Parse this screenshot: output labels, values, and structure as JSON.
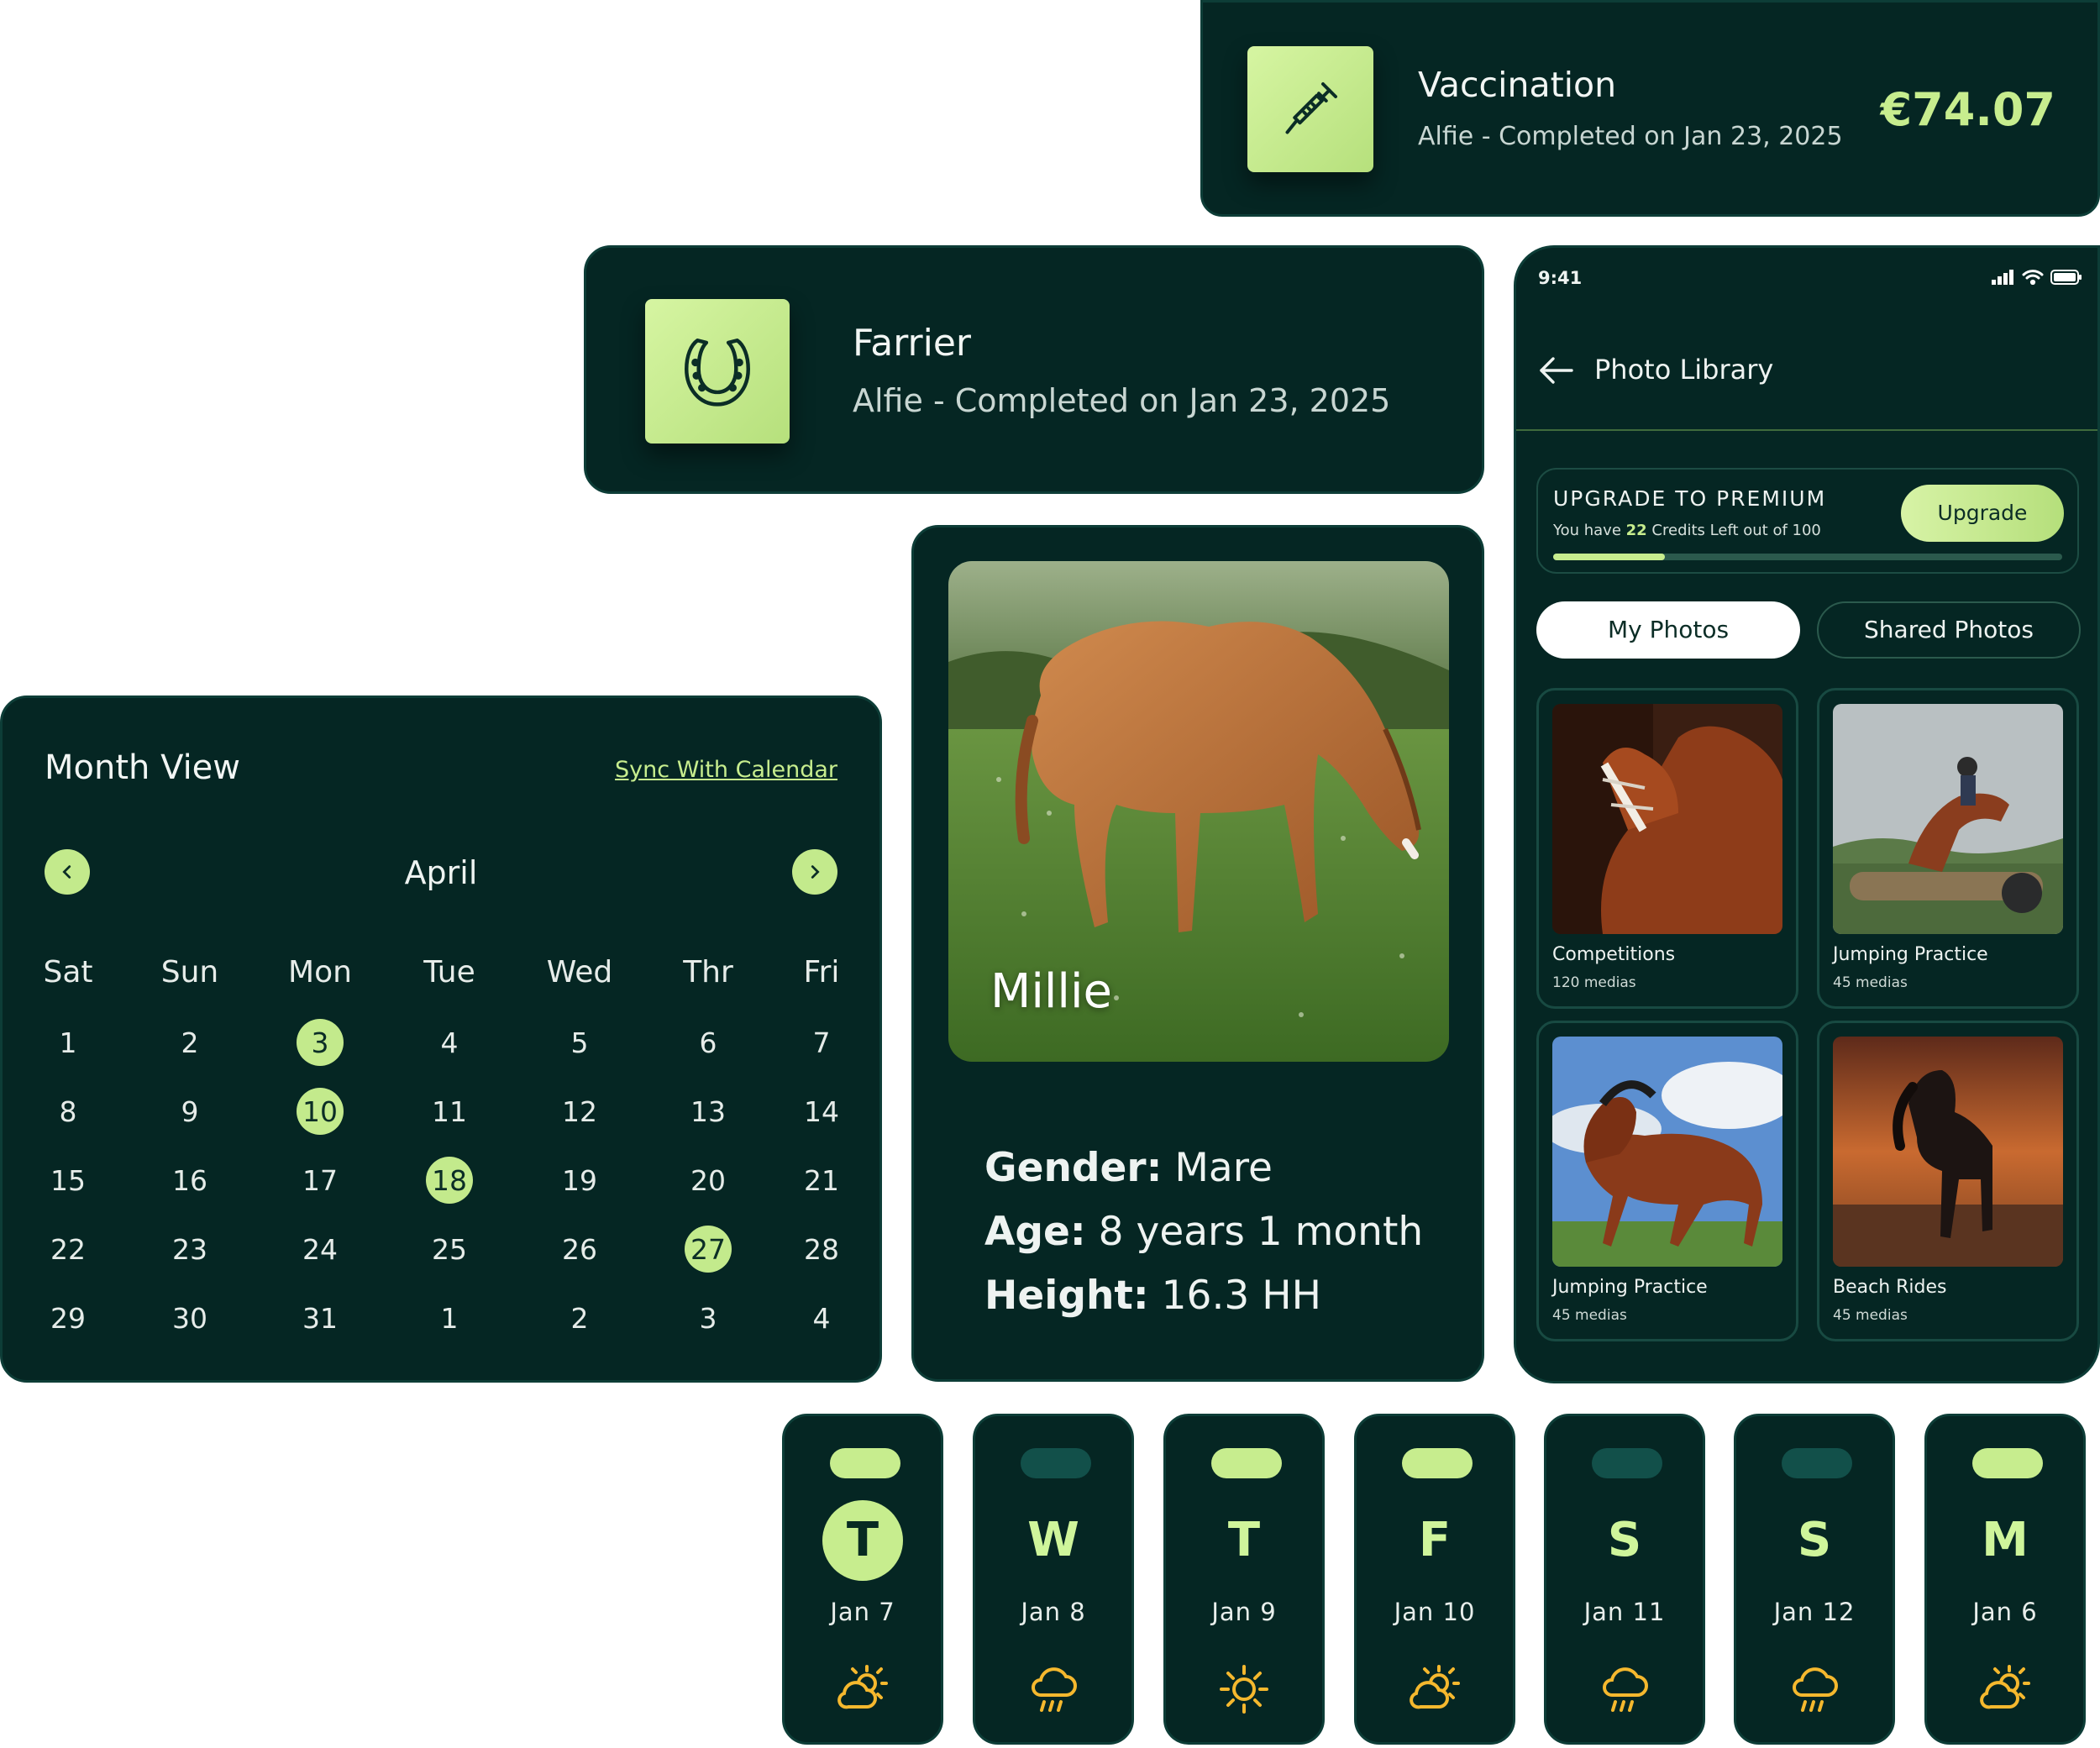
{
  "colors": {
    "card_bg": "#052623",
    "accent": "#c3ea8c",
    "weather_icon": "#f5b82e"
  },
  "vaccination": {
    "icon": "syringe-icon",
    "title": "Vaccination",
    "subtitle": "Alfie - Completed on Jan 23, 2025",
    "price": "€74.07"
  },
  "farrier": {
    "icon": "horseshoe-icon",
    "title": "Farrier",
    "subtitle": "Alfie - Completed on Jan 23, 2025"
  },
  "calendar": {
    "title": "Month View",
    "sync_link": "Sync With Calendar",
    "month": "April",
    "prev_icon": "chevron-left-icon",
    "next_icon": "chevron-right-icon",
    "weekdays": [
      "Sat",
      "Sun",
      "Mon",
      "Tue",
      "Wed",
      "Thr",
      "Fri"
    ],
    "weeks": [
      [
        "1",
        "2",
        "3",
        "4",
        "5",
        "6",
        "7"
      ],
      [
        "8",
        "9",
        "10",
        "11",
        "12",
        "13",
        "14"
      ],
      [
        "15",
        "16",
        "17",
        "18",
        "19",
        "20",
        "21"
      ],
      [
        "22",
        "23",
        "24",
        "25",
        "26",
        "27",
        "28"
      ],
      [
        "29",
        "30",
        "31",
        "1",
        "2",
        "3",
        "4"
      ]
    ],
    "highlighted": [
      "3",
      "10",
      "18",
      "27"
    ]
  },
  "horse": {
    "name": "Millie",
    "gender_label": "Gender:",
    "gender": "Mare",
    "age_label": "Age:",
    "age": "8 years 1 month",
    "height_label": "Height:",
    "height": "16.3 HH"
  },
  "phone": {
    "time": "9:41",
    "title": "Photo Library",
    "back_icon": "arrow-left-icon",
    "premium": {
      "heading": "UPGRADE TO PREMIUM",
      "text_before": "You have ",
      "credits": "22",
      "text_after": " Credits Left out of 100",
      "button": "Upgrade",
      "progress": 0.22
    },
    "tabs": [
      "My Photos",
      "Shared Photos"
    ],
    "active_tab": "My Photos",
    "albums": [
      {
        "name": "Competitions",
        "count": "120 medias"
      },
      {
        "name": "Jumping Practice",
        "count": "45 medias"
      },
      {
        "name": "Jumping Practice",
        "count": "45 medias"
      },
      {
        "name": "Beach Rides",
        "count": "45 medias"
      }
    ]
  },
  "weather": [
    {
      "letter": "T",
      "date": "Jan 7",
      "icon": "partly-sunny-icon",
      "pill": "on",
      "selected": true
    },
    {
      "letter": "W",
      "date": "Jan 8",
      "icon": "rain-cloud-icon",
      "pill": "off",
      "selected": false
    },
    {
      "letter": "T",
      "date": "Jan 9",
      "icon": "sun-icon",
      "pill": "on",
      "selected": false
    },
    {
      "letter": "F",
      "date": "Jan 10",
      "icon": "partly-sunny-icon",
      "pill": "on",
      "selected": false
    },
    {
      "letter": "S",
      "date": "Jan 11",
      "icon": "rain-cloud-icon",
      "pill": "off",
      "selected": false
    },
    {
      "letter": "S",
      "date": "Jan 12",
      "icon": "rain-cloud-icon",
      "pill": "off",
      "selected": false
    },
    {
      "letter": "M",
      "date": "Jan 6",
      "icon": "partly-sunny-icon",
      "pill": "on",
      "selected": false
    }
  ]
}
